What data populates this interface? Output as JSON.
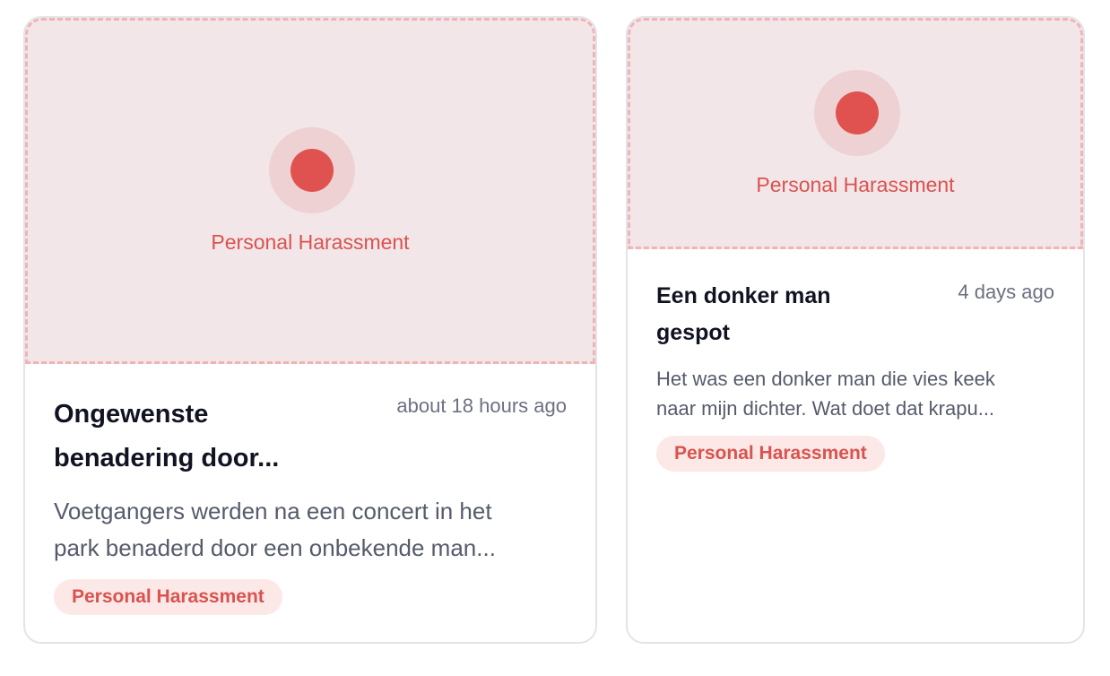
{
  "cards": [
    {
      "media_label": "Personal Harassment",
      "title_line1": "Ongewenste",
      "title_line2": "benadering door...",
      "time": "about 18 hours ago",
      "desc_line1": "Voetgangers werden na een concert in het",
      "desc_line2": "park benaderd door een onbekende man...",
      "badge": "Personal Harassment"
    },
    {
      "media_label": "Personal Harassment",
      "title_line1": "Een donker man",
      "title_line2": "gespot",
      "time": "4 days ago",
      "desc_line1": "Het was een donker man die vies keek",
      "desc_line2": "naar mijn dichter. Wat doet dat krapu...",
      "badge": "Personal Harassment"
    }
  ],
  "colors": {
    "accent": "#df524f",
    "media_bg": "#f2e6e8",
    "badge_bg": "#fce8e6"
  },
  "icons": {
    "media_marker": "red-dot-icon"
  }
}
